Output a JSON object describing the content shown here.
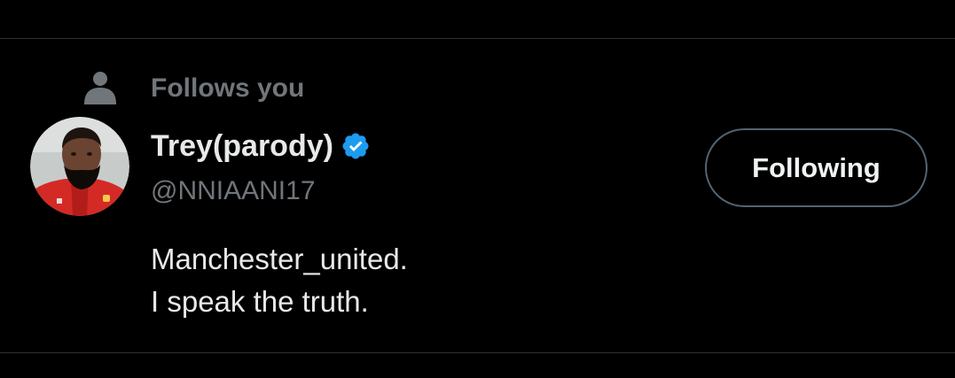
{
  "social_context": {
    "label": "Follows you",
    "icon": "person-icon"
  },
  "user": {
    "display_name": "Trey(parody)",
    "verified_icon": "verified-badge-icon",
    "handle": "@NNIAANI17",
    "bio_lines": [
      "Manchester_united.",
      "I speak the truth."
    ],
    "avatar_icon": "avatar"
  },
  "follow_button": {
    "label": "Following"
  },
  "colors": {
    "background": "#000000",
    "primary_text": "#e7e9ea",
    "secondary_text": "#71767b",
    "divider": "#2f3336",
    "button_border": "#536471",
    "verified_blue": "#1d9bf0"
  }
}
